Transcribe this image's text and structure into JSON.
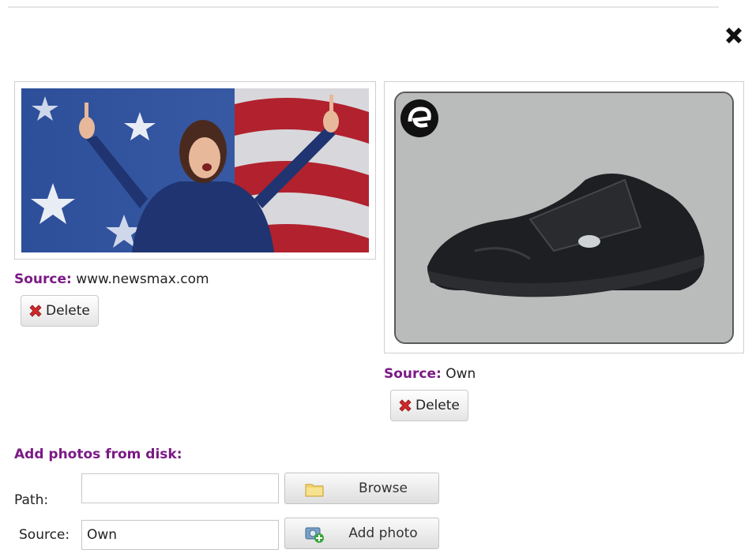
{
  "dialog": {
    "close_icon": "close-x-icon"
  },
  "photos": [
    {
      "image_alt": "Woman in blue jacket gesturing with raised index fingers in front of an American flag",
      "source_label": "Source:",
      "source_value": "www.newsmax.com",
      "delete_label": "Delete"
    },
    {
      "image_alt": "Black leather sneaker with velcro strap on grey background",
      "source_label": "Source:",
      "source_value": "Own",
      "delete_label": "Delete"
    }
  ],
  "add_photos": {
    "title": "Add photos from disk:",
    "path_label": "Path:",
    "path_value": "",
    "browse_label": "Browse",
    "source_label": "Source:",
    "source_value": "Own",
    "add_label": "Add photo"
  },
  "colors": {
    "accent": "#7b1a86"
  }
}
